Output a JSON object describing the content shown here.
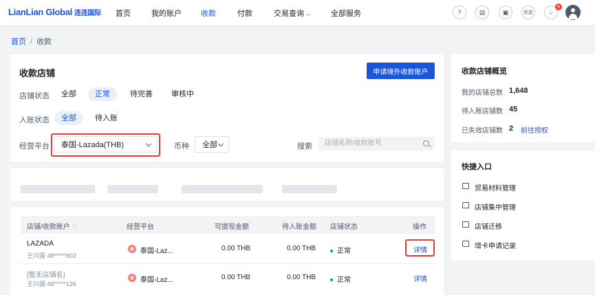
{
  "header": {
    "logo_en": "LianLian Global",
    "logo_cn": "连连国际",
    "nav": [
      "首页",
      "我的账户",
      "收款",
      "付款",
      "交易查询",
      "全部服务"
    ],
    "icons": [
      "help-icon",
      "document-icon",
      "wallet-icon",
      "vip-icon",
      "bell-icon"
    ],
    "vip_label": "优店",
    "notify_count": "9"
  },
  "breadcrumb": {
    "home": "首页",
    "separator": "/",
    "current": "收款"
  },
  "stores": {
    "title": "收款店铺",
    "apply_button": "申请境外收款账户",
    "status_label": "店铺状态",
    "status_options": [
      "全部",
      "正常",
      "待完善",
      "审核中"
    ],
    "status_selected": "正常",
    "entry_label": "入账状态",
    "entry_options": [
      "全部",
      "待入账"
    ],
    "entry_selected": "全部",
    "platform_label": "经营平台",
    "platform_value": "泰国-Lazada(THB)",
    "currency_label": "币种",
    "currency_value": "全部",
    "search_label": "搜索",
    "search_placeholder": "店铺名称/收款账号"
  },
  "table": {
    "columns": [
      "店铺/收款账户",
      "经营平台",
      "可提现金额",
      "待入账金额",
      "店铺状态",
      "操作"
    ],
    "rows": [
      {
        "name": "LAZADA",
        "owner": "王兴国 48*****802",
        "platform": "泰国-Laz...",
        "available": "0.00 THB",
        "pending": "0.00 THB",
        "status": "正常",
        "action": "详情"
      },
      {
        "name": "[暂无店铺名]",
        "owner": "王兴国 48*****126",
        "platform": "泰国-Laz...",
        "available": "0.00 THB",
        "pending": "0.00 THB",
        "status": "正常",
        "action": "详情"
      }
    ]
  },
  "overview": {
    "title": "收款店铺概览",
    "items": [
      {
        "label": "我的店铺总数",
        "value": "1,648"
      },
      {
        "label": "待入账店铺数",
        "value": "45"
      },
      {
        "label": "已失效店铺数",
        "value": "2",
        "link": "前往授权"
      }
    ]
  },
  "quick": {
    "title": "快捷入口",
    "items": [
      "贸易材料管理",
      "店铺集中管理",
      "店铺迁移",
      "增卡申请记录"
    ]
  },
  "colors": {
    "primary": "#1a56db",
    "highlight": "#e53935",
    "status_ok": "#00b42a"
  }
}
